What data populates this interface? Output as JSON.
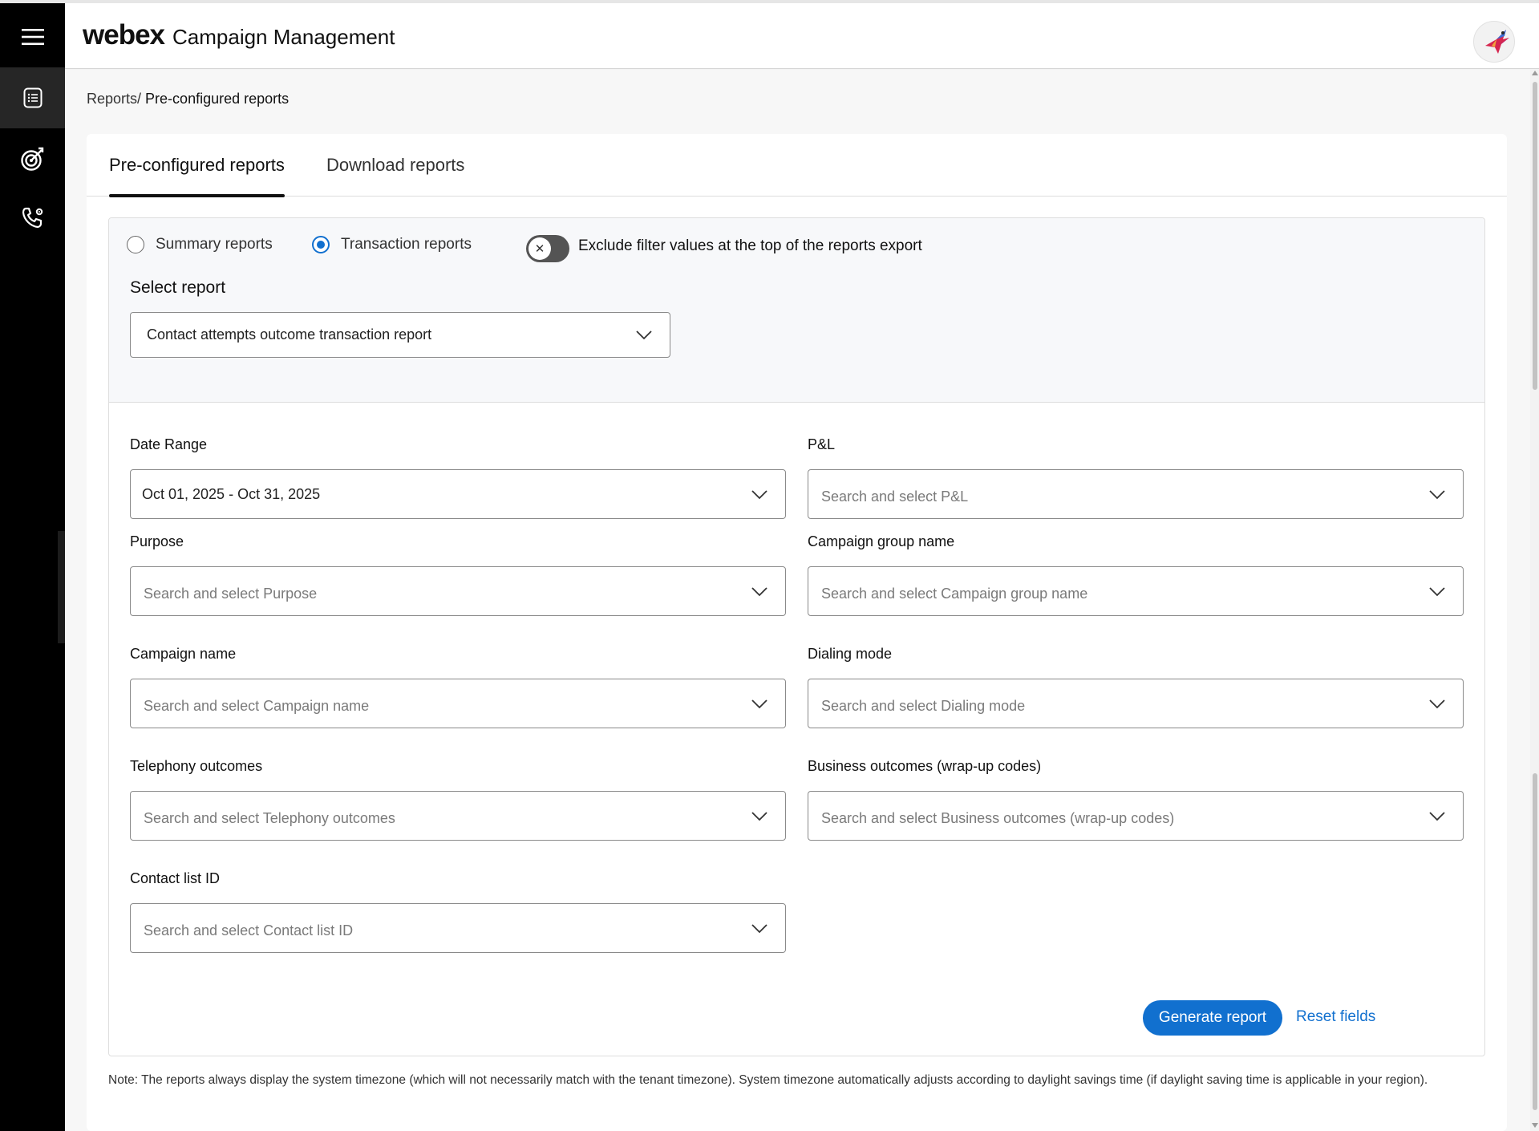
{
  "header": {
    "brand": "webex",
    "title": "Campaign Management",
    "avatar_icon": "bird-logo-icon"
  },
  "rail": {
    "menu_icon": "hamburger-menu-icon",
    "items": [
      {
        "icon": "report-list-icon",
        "active": true
      },
      {
        "icon": "target-icon",
        "active": false
      },
      {
        "icon": "phone-gear-icon",
        "active": false
      }
    ]
  },
  "breadcrumb": {
    "parent": "Reports/",
    "current": "Pre-configured reports"
  },
  "tabs": [
    {
      "label": "Pre-configured reports",
      "active": true
    },
    {
      "label": "Download reports",
      "active": false
    }
  ],
  "report_type": {
    "summary_label": "Summary reports",
    "transaction_label": "Transaction reports",
    "selected": "Transaction reports"
  },
  "exclude_toggle": {
    "label": "Exclude filter values at the top of the reports export",
    "on": false
  },
  "select_report": {
    "label": "Select report",
    "value": "Contact attempts outcome transaction report"
  },
  "filters": {
    "date_range": {
      "label": "Date Range",
      "value": "Oct 01, 2025 - Oct 31, 2025"
    },
    "pnl": {
      "label": "P&L",
      "placeholder": "Search and select P&L"
    },
    "purpose": {
      "label": "Purpose",
      "placeholder": "Search and select Purpose"
    },
    "campaign_group": {
      "label": "Campaign group name",
      "placeholder": "Search and select Campaign group name"
    },
    "campaign_name": {
      "label": "Campaign name",
      "placeholder": "Search and select Campaign name"
    },
    "dialing_mode": {
      "label": "Dialing mode",
      "placeholder": "Search and select Dialing mode"
    },
    "telephony": {
      "label": "Telephony outcomes",
      "placeholder": "Search and select Telephony outcomes"
    },
    "business": {
      "label": "Business outcomes (wrap-up codes)",
      "placeholder": "Search and select Business outcomes (wrap-up codes)"
    },
    "contact_list": {
      "label": "Contact list ID",
      "placeholder": "Search and select Contact list ID"
    }
  },
  "actions": {
    "generate_label": "Generate report",
    "reset_label": "Reset fields"
  },
  "note": "Note: The reports always display the system timezone (which will not necessarily match with the tenant timezone). System timezone automatically adjusts according to daylight savings time (if daylight saving time is applicable in your region).",
  "colors": {
    "accent": "#1170cf",
    "rail": "#000000",
    "toggle_off": "#545454"
  }
}
